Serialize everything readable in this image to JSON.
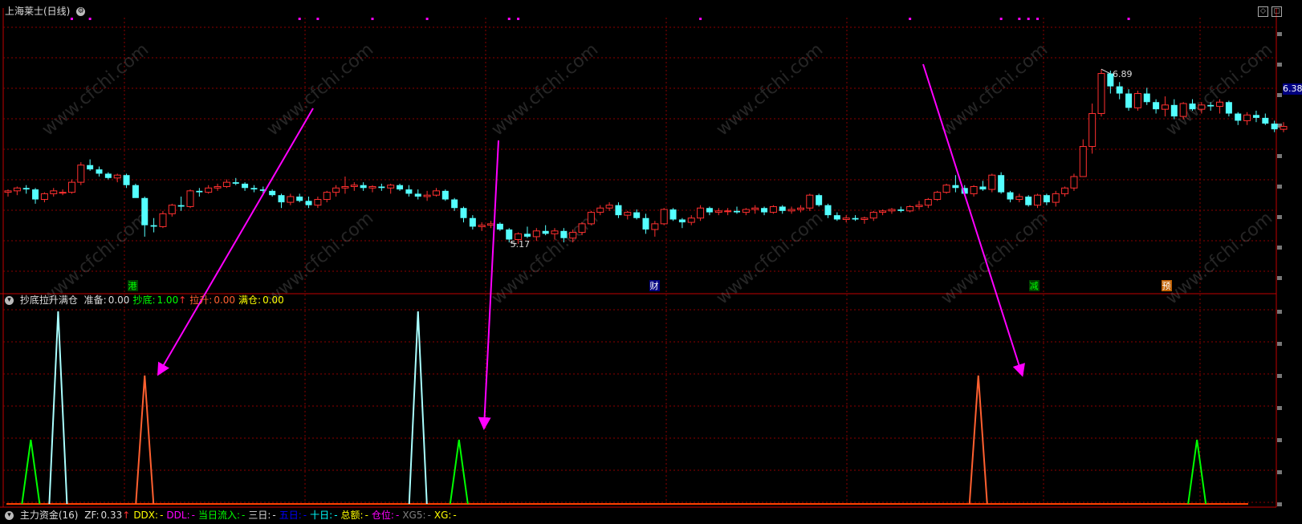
{
  "title_bar": {
    "stock_title": "上海莱士(日线)"
  },
  "price_panel": {
    "high_label": "6.89",
    "low_label": "5.17",
    "last_price_tag": "6.38",
    "event_markers": [
      {
        "text": "港",
        "color": "#00ff00",
        "bg": "#004000"
      },
      {
        "text": "财",
        "color": "#ffffff",
        "bg": "#000080"
      },
      {
        "text": "减",
        "color": "#00ff00",
        "bg": "#004000"
      },
      {
        "text": "预",
        "color": "#ffffff",
        "bg": "#c06000"
      }
    ],
    "candles": [
      [
        5.73,
        5.75,
        5.7,
        5.74
      ],
      [
        5.74,
        5.77,
        5.71,
        5.76
      ],
      [
        5.76,
        5.78,
        5.72,
        5.75
      ],
      [
        5.75,
        5.76,
        5.65,
        5.68
      ],
      [
        5.68,
        5.73,
        5.66,
        5.72
      ],
      [
        5.72,
        5.76,
        5.7,
        5.74
      ],
      [
        5.73,
        5.75,
        5.71,
        5.73
      ],
      [
        5.73,
        5.82,
        5.72,
        5.8
      ],
      [
        5.8,
        5.94,
        5.78,
        5.92
      ],
      [
        5.92,
        5.96,
        5.88,
        5.89
      ],
      [
        5.89,
        5.91,
        5.84,
        5.86
      ],
      [
        5.86,
        5.87,
        5.82,
        5.83
      ],
      [
        5.83,
        5.86,
        5.8,
        5.85
      ],
      [
        5.85,
        5.86,
        5.76,
        5.78
      ],
      [
        5.78,
        5.79,
        5.71,
        5.69
      ],
      [
        5.69,
        5.7,
        5.42,
        5.5
      ],
      [
        5.5,
        5.55,
        5.45,
        5.49
      ],
      [
        5.49,
        5.6,
        5.48,
        5.58
      ],
      [
        5.58,
        5.65,
        5.56,
        5.64
      ],
      [
        5.64,
        5.7,
        5.6,
        5.63
      ],
      [
        5.63,
        5.75,
        5.62,
        5.74
      ],
      [
        5.74,
        5.76,
        5.7,
        5.73
      ],
      [
        5.73,
        5.78,
        5.72,
        5.76
      ],
      [
        5.76,
        5.79,
        5.74,
        5.77
      ],
      [
        5.77,
        5.82,
        5.76,
        5.8
      ],
      [
        5.8,
        5.83,
        5.78,
        5.79
      ],
      [
        5.79,
        5.8,
        5.74,
        5.76
      ],
      [
        5.76,
        5.78,
        5.73,
        5.75
      ],
      [
        5.75,
        5.77,
        5.72,
        5.74
      ],
      [
        5.74,
        5.75,
        5.7,
        5.71
      ],
      [
        5.71,
        5.72,
        5.62,
        5.66
      ],
      [
        5.66,
        5.72,
        5.64,
        5.7
      ],
      [
        5.7,
        5.72,
        5.66,
        5.67
      ],
      [
        5.67,
        5.7,
        5.62,
        5.64
      ],
      [
        5.64,
        5.7,
        5.62,
        5.68
      ],
      [
        5.68,
        5.74,
        5.66,
        5.73
      ],
      [
        5.73,
        5.78,
        5.7,
        5.76
      ],
      [
        5.76,
        5.84,
        5.72,
        5.77
      ],
      [
        5.77,
        5.8,
        5.74,
        5.78
      ],
      [
        5.78,
        5.8,
        5.74,
        5.76
      ],
      [
        5.76,
        5.78,
        5.73,
        5.77
      ],
      [
        5.77,
        5.79,
        5.74,
        5.76
      ],
      [
        5.76,
        5.79,
        5.72,
        5.78
      ],
      [
        5.78,
        5.79,
        5.74,
        5.75
      ],
      [
        5.75,
        5.78,
        5.7,
        5.72
      ],
      [
        5.72,
        5.75,
        5.68,
        5.7
      ],
      [
        5.7,
        5.74,
        5.67,
        5.71
      ],
      [
        5.71,
        5.76,
        5.7,
        5.74
      ],
      [
        5.74,
        5.75,
        5.67,
        5.68
      ],
      [
        5.68,
        5.69,
        5.6,
        5.62
      ],
      [
        5.62,
        5.63,
        5.52,
        5.55
      ],
      [
        5.55,
        5.57,
        5.47,
        5.49
      ],
      [
        5.49,
        5.52,
        5.46,
        5.5
      ],
      [
        5.5,
        5.53,
        5.48,
        5.51
      ],
      [
        5.51,
        5.52,
        5.46,
        5.47
      ],
      [
        5.47,
        5.48,
        5.38,
        5.4
      ],
      [
        5.4,
        5.45,
        5.37,
        5.44
      ],
      [
        5.44,
        5.49,
        5.41,
        5.42
      ],
      [
        5.42,
        5.48,
        5.39,
        5.46
      ],
      [
        5.46,
        5.5,
        5.43,
        5.44
      ],
      [
        5.44,
        5.48,
        5.4,
        5.46
      ],
      [
        5.46,
        5.48,
        5.38,
        5.41
      ],
      [
        5.41,
        5.47,
        5.38,
        5.45
      ],
      [
        5.45,
        5.52,
        5.43,
        5.51
      ],
      [
        5.51,
        5.6,
        5.5,
        5.59
      ],
      [
        5.59,
        5.64,
        5.57,
        5.62
      ],
      [
        5.62,
        5.66,
        5.6,
        5.64
      ],
      [
        5.64,
        5.66,
        5.55,
        5.57
      ],
      [
        5.57,
        5.6,
        5.54,
        5.59
      ],
      [
        5.59,
        5.61,
        5.54,
        5.55
      ],
      [
        5.55,
        5.58,
        5.44,
        5.47
      ],
      [
        5.47,
        5.53,
        5.42,
        5.51
      ],
      [
        5.51,
        5.62,
        5.5,
        5.61
      ],
      [
        5.61,
        5.62,
        5.53,
        5.54
      ],
      [
        5.54,
        5.55,
        5.48,
        5.52
      ],
      [
        5.52,
        5.57,
        5.5,
        5.55
      ],
      [
        5.55,
        5.64,
        5.53,
        5.62
      ],
      [
        5.62,
        5.63,
        5.57,
        5.59
      ],
      [
        5.59,
        5.62,
        5.57,
        5.6
      ],
      [
        5.6,
        5.62,
        5.57,
        5.6
      ],
      [
        5.6,
        5.63,
        5.58,
        5.59
      ],
      [
        5.59,
        5.62,
        5.57,
        5.61
      ],
      [
        5.61,
        5.64,
        5.58,
        5.62
      ],
      [
        5.62,
        5.63,
        5.57,
        5.59
      ],
      [
        5.59,
        5.64,
        5.58,
        5.63
      ],
      [
        5.63,
        5.64,
        5.58,
        5.6
      ],
      [
        5.6,
        5.63,
        5.58,
        5.61
      ],
      [
        5.61,
        5.64,
        5.59,
        5.62
      ],
      [
        5.62,
        5.72,
        5.6,
        5.71
      ],
      [
        5.71,
        5.72,
        5.63,
        5.64
      ],
      [
        5.64,
        5.65,
        5.55,
        5.57
      ],
      [
        5.57,
        5.59,
        5.53,
        5.54
      ],
      [
        5.54,
        5.57,
        5.52,
        5.55
      ],
      [
        5.55,
        5.57,
        5.53,
        5.54
      ],
      [
        5.54,
        5.56,
        5.51,
        5.55
      ],
      [
        5.55,
        5.6,
        5.53,
        5.59
      ],
      [
        5.59,
        5.61,
        5.57,
        5.6
      ],
      [
        5.6,
        5.62,
        5.58,
        5.61
      ],
      [
        5.61,
        5.63,
        5.59,
        5.6
      ],
      [
        5.6,
        5.64,
        5.59,
        5.63
      ],
      [
        5.63,
        5.67,
        5.61,
        5.64
      ],
      [
        5.64,
        5.69,
        5.62,
        5.68
      ],
      [
        5.68,
        5.74,
        5.67,
        5.73
      ],
      [
        5.73,
        5.79,
        5.72,
        5.78
      ],
      [
        5.78,
        5.85,
        5.73,
        5.76
      ],
      [
        5.76,
        5.78,
        5.71,
        5.72
      ],
      [
        5.72,
        5.78,
        5.7,
        5.77
      ],
      [
        5.77,
        5.81,
        5.74,
        5.75
      ],
      [
        5.75,
        5.86,
        5.73,
        5.85
      ],
      [
        5.85,
        5.87,
        5.72,
        5.73
      ],
      [
        5.73,
        5.74,
        5.66,
        5.68
      ],
      [
        5.68,
        5.72,
        5.66,
        5.7
      ],
      [
        5.7,
        5.71,
        5.63,
        5.64
      ],
      [
        5.64,
        5.72,
        5.62,
        5.71
      ],
      [
        5.71,
        5.72,
        5.64,
        5.66
      ],
      [
        5.66,
        5.74,
        5.63,
        5.72
      ],
      [
        5.72,
        5.77,
        5.7,
        5.76
      ],
      [
        5.76,
        5.86,
        5.74,
        5.84
      ],
      [
        5.84,
        6.1,
        5.88,
        6.05
      ],
      [
        6.05,
        6.35,
        6.0,
        6.28
      ],
      [
        6.28,
        6.59,
        6.26,
        6.56
      ],
      [
        6.56,
        6.58,
        6.42,
        6.47
      ],
      [
        6.47,
        6.5,
        6.38,
        6.42
      ],
      [
        6.42,
        6.45,
        6.3,
        6.32
      ],
      [
        6.32,
        6.44,
        6.3,
        6.42
      ],
      [
        6.42,
        6.46,
        6.34,
        6.36
      ],
      [
        6.36,
        6.38,
        6.28,
        6.31
      ],
      [
        6.31,
        6.4,
        6.26,
        6.34
      ],
      [
        6.34,
        6.38,
        6.24,
        6.26
      ],
      [
        6.26,
        6.36,
        6.24,
        6.35
      ],
      [
        6.35,
        6.38,
        6.3,
        6.31
      ],
      [
        6.31,
        6.36,
        6.28,
        6.34
      ],
      [
        6.34,
        6.36,
        6.3,
        6.33
      ],
      [
        6.33,
        6.38,
        6.28,
        6.36
      ],
      [
        6.36,
        6.37,
        6.26,
        6.28
      ],
      [
        6.28,
        6.29,
        6.2,
        6.23
      ],
      [
        6.23,
        6.29,
        6.2,
        6.27
      ],
      [
        6.27,
        6.3,
        6.22,
        6.25
      ],
      [
        6.25,
        6.28,
        6.2,
        6.21
      ],
      [
        6.21,
        6.23,
        6.15,
        6.17
      ],
      [
        6.17,
        6.22,
        6.15,
        6.19
      ]
    ]
  },
  "indicator_panel": {
    "title": "抄底拉升满仓",
    "fields": [
      {
        "label": "准备:",
        "value": "0.00",
        "color": "#dddddd",
        "arrow": ""
      },
      {
        "label": "抄底:",
        "value": "1.00",
        "color": "#00ff00",
        "arrow": "↑"
      },
      {
        "label": "拉升:",
        "value": "0.00",
        "color": "#ff6030",
        "arrow": ""
      },
      {
        "label": "满仓:",
        "value": "0.00",
        "color": "#ffff00",
        "arrow": ""
      }
    ],
    "spikes": [
      {
        "idx": 2.5,
        "level": 2,
        "color": "#00ff00"
      },
      {
        "idx": 5.5,
        "level": 6,
        "color": "#aaffff"
      },
      {
        "idx": 15.0,
        "level": 4,
        "color": "#ff6030"
      },
      {
        "idx": 45.0,
        "level": 6,
        "color": "#aaffff"
      },
      {
        "idx": 49.5,
        "level": 2,
        "color": "#00ff00"
      },
      {
        "idx": 106.5,
        "level": 4,
        "color": "#ff6030"
      },
      {
        "idx": 130.5,
        "level": 2,
        "color": "#00ff00"
      }
    ]
  },
  "bottom_bar": {
    "title": "主力资金(16)",
    "fields": [
      {
        "label": "ZF:",
        "value": "0.33",
        "color": "#dddddd",
        "arrow": "↑"
      },
      {
        "label": "DDX:",
        "value": "-",
        "color": "#ffff00",
        "arrow": ""
      },
      {
        "label": "DDL:",
        "value": "-",
        "color": "#ff00ff",
        "arrow": ""
      },
      {
        "label": "当日流入:",
        "value": "-",
        "color": "#00ff00",
        "arrow": ""
      },
      {
        "label": "三日:",
        "value": "-",
        "color": "#dddddd",
        "arrow": ""
      },
      {
        "label": "五日:",
        "value": "-",
        "color": "#0000ff",
        "arrow": ""
      },
      {
        "label": "十日:",
        "value": "-",
        "color": "#00ffff",
        "arrow": ""
      },
      {
        "label": "总额:",
        "value": "-",
        "color": "#ffff00",
        "arrow": ""
      },
      {
        "label": "仓位:",
        "value": "-",
        "color": "#ff00ff",
        "arrow": ""
      },
      {
        "label": "XG5:",
        "value": "-",
        "color": "#808080",
        "arrow": ""
      },
      {
        "label": "XG:",
        "value": "-",
        "color": "#ffff00",
        "arrow": ""
      }
    ]
  },
  "watermark_text": "www.cfchi.com",
  "colors": {
    "up": "#ff3030",
    "down": "#54ffff",
    "grid": "#8b0000",
    "arrow": "#ff00ff"
  }
}
